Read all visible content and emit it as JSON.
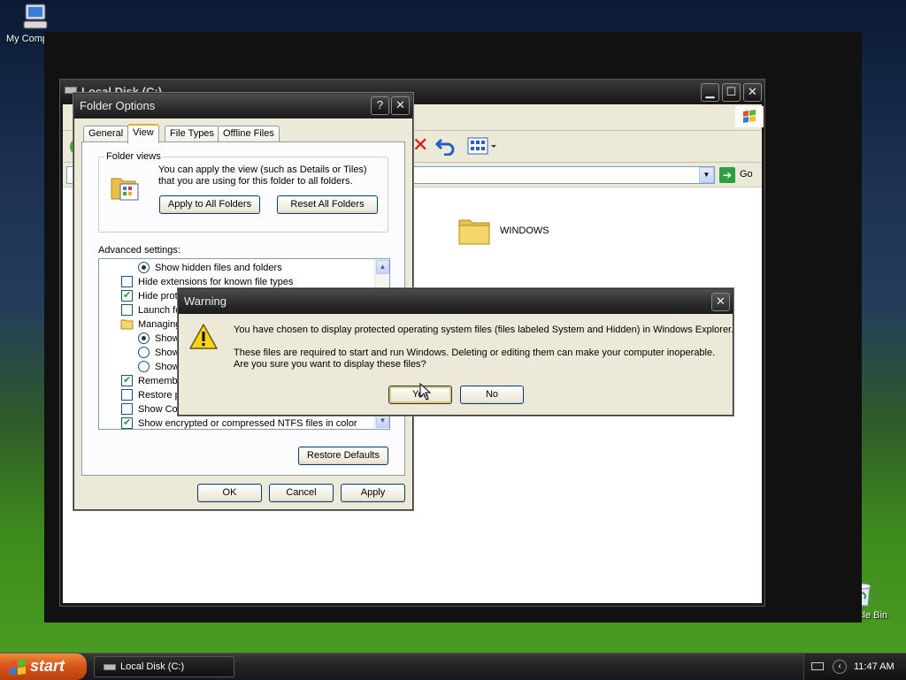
{
  "desktop": {
    "my_computer_label": "My Computer",
    "recycle_bin_label": "Recycle Bin"
  },
  "explorer": {
    "title": "Local Disk (C:)",
    "go_label": "Go",
    "folder_label": "WINDOWS"
  },
  "folder_options": {
    "title": "Folder Options",
    "help_glyph": "?",
    "close_glyph": "✕",
    "tabs": [
      {
        "label": "General"
      },
      {
        "label": "View"
      },
      {
        "label": "File Types"
      },
      {
        "label": "Offline Files"
      }
    ],
    "folder_views": {
      "legend": "Folder views",
      "description": "You can apply the view (such as Details or Tiles) that you are using for this folder to all folders.",
      "apply_all_label": "Apply to All Folders",
      "reset_all_label": "Reset All Folders"
    },
    "advanced_label": "Advanced settings:",
    "settings": [
      {
        "text": "Show hidden files and folders"
      },
      {
        "text": "Hide extensions for known file types"
      },
      {
        "text": "Hide prote"
      },
      {
        "text": "Launch fo"
      },
      {
        "text": "Managing"
      },
      {
        "text": "Show"
      },
      {
        "text": "Show"
      },
      {
        "text": "Show"
      },
      {
        "text": "Remembe"
      },
      {
        "text": "Restore p"
      },
      {
        "text": "Show Co"
      },
      {
        "text": "Show encrypted or compressed NTFS files in color"
      }
    ],
    "restore_defaults_label": "Restore Defaults",
    "ok_label": "OK",
    "cancel_label": "Cancel",
    "apply_label": "Apply"
  },
  "warning": {
    "title": "Warning",
    "close_glyph": "✕",
    "message_1": "You have chosen to display protected operating system files (files labeled System and Hidden) in Windows Explorer.",
    "message_2a": "These files are required to start and run Windows. Deleting or editing them can make your computer inoperable.",
    "message_2b": "Are you sure you want to display these files?",
    "yes_label": "Yes",
    "no_label": "No"
  },
  "taskbar": {
    "start_label": "start",
    "task_label": "Local Disk (C:)",
    "clock": "11:47 AM"
  },
  "colors": {
    "dialog_face": "#ece9d8",
    "start_orange": "#d6531a",
    "focus_ring": "#f6c35d"
  },
  "icons": [
    "my-computer-icon",
    "recycle-bin-icon",
    "folder-icon",
    "warning-icon",
    "windows-flag-icon",
    "go-arrow-icon",
    "undo-icon",
    "views-icon",
    "delete-icon"
  ]
}
